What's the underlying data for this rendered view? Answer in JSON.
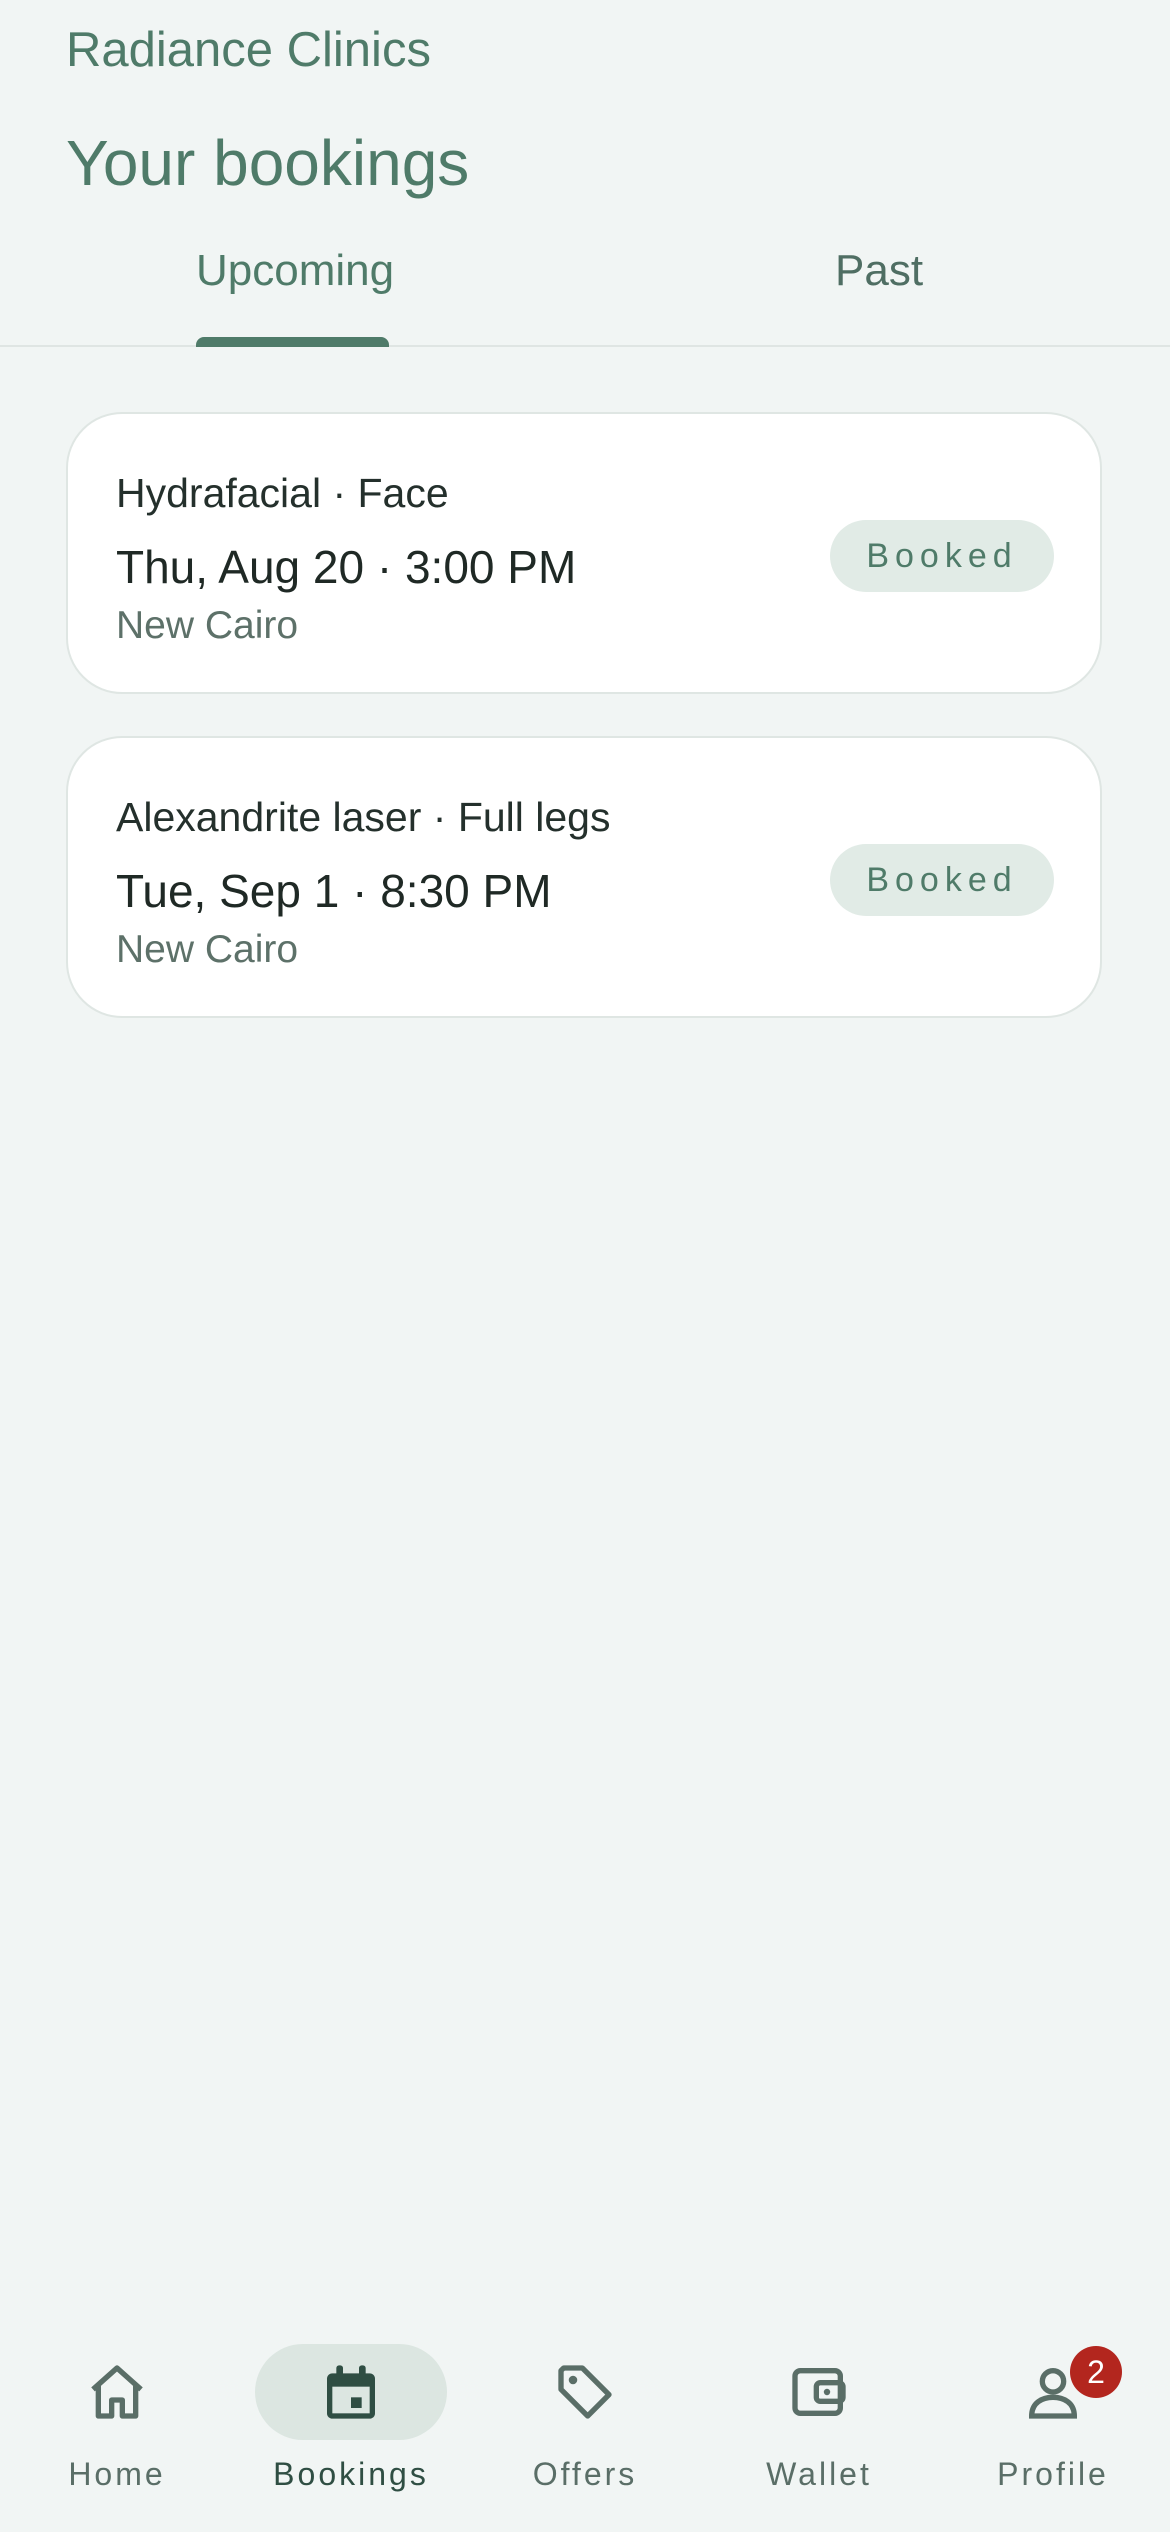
{
  "header": {
    "app_name": "Radiance Clinics",
    "title": "Your bookings"
  },
  "tabs": [
    {
      "label": "Upcoming",
      "active": true
    },
    {
      "label": "Past",
      "active": false
    }
  ],
  "bookings": [
    {
      "service": "Hydrafacial · Face",
      "datetime": "Thu, Aug 20 · 3:00 PM",
      "location": "New Cairo",
      "status": "Booked"
    },
    {
      "service": "Alexandrite laser · Full legs",
      "datetime": "Tue, Sep 1 · 8:30 PM",
      "location": "New Cairo",
      "status": "Booked"
    }
  ],
  "nav": [
    {
      "label": "Home",
      "icon": "home-icon"
    },
    {
      "label": "Bookings",
      "icon": "calendar-icon",
      "active": true
    },
    {
      "label": "Offers",
      "icon": "tag-icon"
    },
    {
      "label": "Wallet",
      "icon": "wallet-icon"
    },
    {
      "label": "Profile",
      "icon": "person-icon",
      "badge": "2"
    }
  ],
  "colors": {
    "accent": "#4f7b69",
    "background": "#f1f5f4",
    "badge": "#b3261e"
  }
}
